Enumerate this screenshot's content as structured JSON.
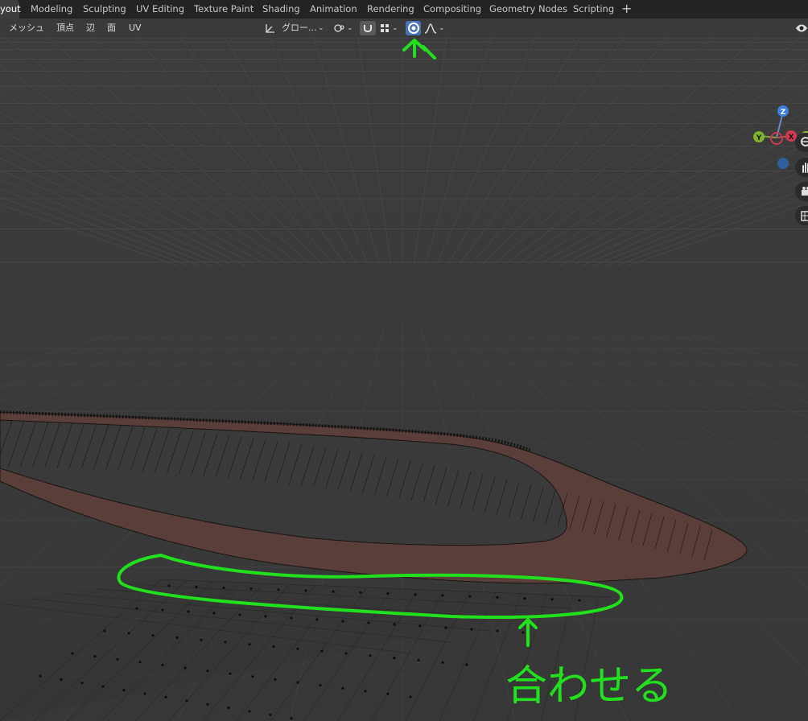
{
  "workspace_tabs": [
    {
      "label": "yout",
      "active": true
    },
    {
      "label": "Modeling",
      "active": false
    },
    {
      "label": "Sculpting",
      "active": false
    },
    {
      "label": "UV Editing",
      "active": false
    },
    {
      "label": "Texture Paint",
      "active": false
    },
    {
      "label": "Shading",
      "active": false
    },
    {
      "label": "Animation",
      "active": false
    },
    {
      "label": "Rendering",
      "active": false
    },
    {
      "label": "Compositing",
      "active": false
    },
    {
      "label": "Geometry Nodes",
      "active": false
    },
    {
      "label": "Scripting",
      "active": false
    }
  ],
  "add_workspace_label": "+",
  "viewport_menu": {
    "mesh": "メッシュ",
    "vertex": "頂点",
    "edge": "辺",
    "face": "面",
    "uv": "UV"
  },
  "header_tools": {
    "transform_orientation": "グロー...",
    "proportional_editing_active": true
  },
  "gizmo": {
    "z": "Z",
    "y": "Y",
    "x": "X"
  },
  "annotation": {
    "text": "合わせる",
    "color": "#22e01e"
  },
  "colors": {
    "accent": "#4772b3",
    "mesh_face": "#5a3e3a",
    "annotation": "#22e01e"
  }
}
